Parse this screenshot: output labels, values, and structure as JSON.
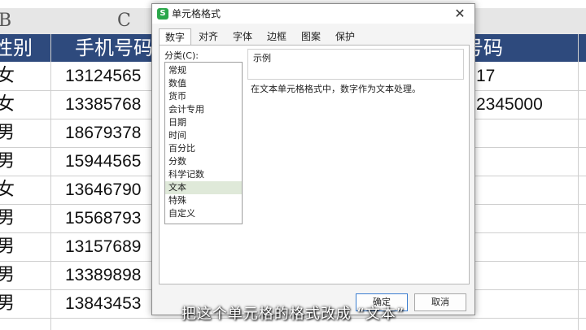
{
  "sheet": {
    "col_letters": [
      "B",
      "C"
    ],
    "headers": {
      "gender": "性别",
      "phone": "手机号码",
      "right": "号码"
    },
    "rows": [
      {
        "gender": "女",
        "phone": "13124565",
        "right": "17"
      },
      {
        "gender": "女",
        "phone": "13385768",
        "right": "2345000"
      },
      {
        "gender": "男",
        "phone": "18679378",
        "right": ""
      },
      {
        "gender": "男",
        "phone": "15944565",
        "right": ""
      },
      {
        "gender": "女",
        "phone": "13646790",
        "right": ""
      },
      {
        "gender": "男",
        "phone": "15568793",
        "right": ""
      },
      {
        "gender": "男",
        "phone": "13157689",
        "right": ""
      },
      {
        "gender": "男",
        "phone": "13389898",
        "right": ""
      },
      {
        "gender": "男",
        "phone": "13843453",
        "right": ""
      }
    ]
  },
  "dialog": {
    "app_icon": "S",
    "title": "单元格格式",
    "close": "✕",
    "tabs": [
      "数字",
      "对齐",
      "字体",
      "边框",
      "图案",
      "保护"
    ],
    "active_tab": "数字",
    "category_label": "分类(C):",
    "categories": [
      "常规",
      "数值",
      "货币",
      "会计专用",
      "日期",
      "时间",
      "百分比",
      "分数",
      "科学记数",
      "文本",
      "特殊",
      "自定义"
    ],
    "selected_category": "文本",
    "example_label": "示例",
    "description": "在文本单元格格式中，数字作为文本处理。",
    "ok_label": "确定",
    "cancel_label": "取消"
  },
  "subtitle": "把这个单元格的格式改成 “文本”",
  "colors": {
    "header_bg": "#2e4a7d",
    "selected_bg": "#dfe9d9",
    "app_icon": "#2aa74a"
  }
}
